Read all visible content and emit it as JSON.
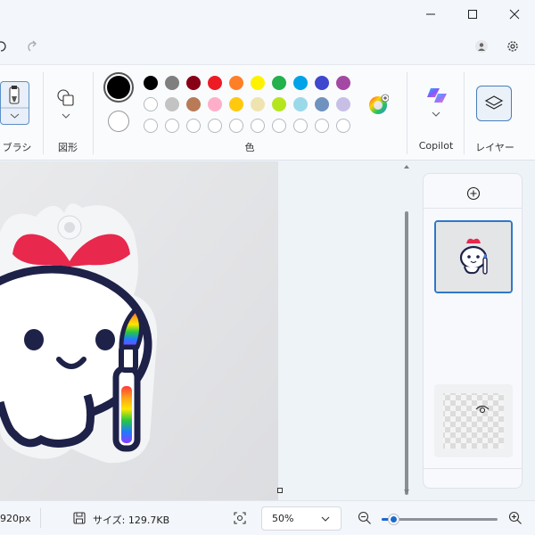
{
  "ribbon": {
    "brush_label": "ブラシ",
    "shapes_label": "図形",
    "color_label": "色",
    "copilot_label": "Copilot",
    "layers_label": "レイヤー",
    "primary_color": "#000000",
    "secondary_color": "#ffffff",
    "palette_row1": [
      "#000000",
      "#7f7f7f",
      "#880015",
      "#ed1c24",
      "#ff7f27",
      "#fff200",
      "#22b14c",
      "#00a2e8",
      "#3f48cc",
      "#a349a4"
    ],
    "palette_row2": [
      "#ffffff",
      "#c3c3c3",
      "#b97a57",
      "#ffaec9",
      "#ffc90e",
      "#efe4b0",
      "#b5e61d",
      "#99d9ea",
      "#7092be",
      "#c8bfe7"
    ],
    "palette_row3_empty_count": 10
  },
  "status": {
    "dimensions_partial": "920px",
    "size_text": "サイズ: 129.7KB",
    "zoom_value": "50%",
    "zoom_level_fraction": 0.1
  },
  "icons": {
    "undo": "undo-icon",
    "redo": "redo-icon",
    "account": "account-icon",
    "settings": "gear-icon",
    "add_layer": "plus-circle-icon",
    "layer_visibility": "eye-icon"
  }
}
